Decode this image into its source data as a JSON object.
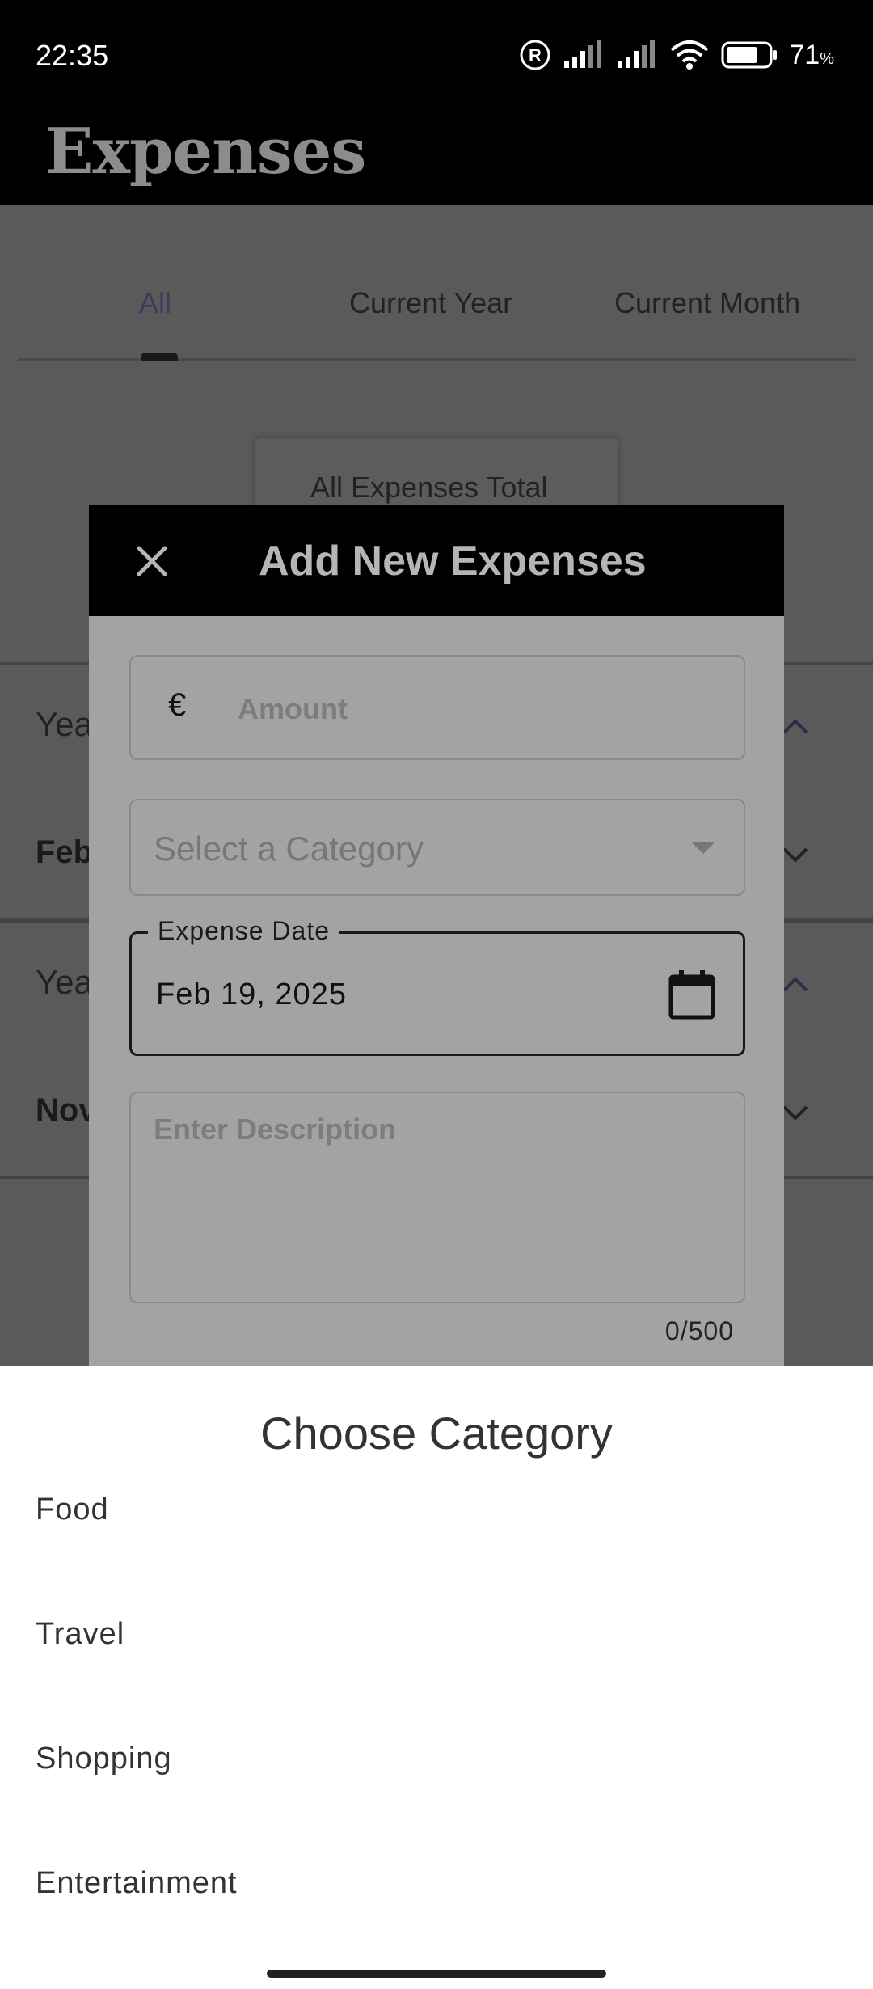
{
  "status": {
    "time": "22:35",
    "battery": "71",
    "battery_unit": "%"
  },
  "app": {
    "title": "Expenses"
  },
  "tabs": [
    {
      "label": "All",
      "active": true
    },
    {
      "label": "Current Year",
      "active": false
    },
    {
      "label": "Current Month",
      "active": false
    }
  ],
  "total_card": {
    "label": "All Expenses Total"
  },
  "groups": [
    {
      "year_label": "Yea",
      "month_label": "Feb"
    },
    {
      "year_label": "Yea",
      "month_label": "Nov"
    }
  ],
  "dialog": {
    "title": "Add New Expenses",
    "amount": {
      "symbol": "€",
      "placeholder": "Amount"
    },
    "category": {
      "placeholder": "Select a Category"
    },
    "date": {
      "label": "Expense Date",
      "value": "Feb 19, 2025"
    },
    "description": {
      "placeholder": "Enter Description",
      "counter": "0/500"
    }
  },
  "sheet": {
    "title": "Choose Category",
    "options": [
      "Food",
      "Travel",
      "Shopping",
      "Entertainment"
    ]
  },
  "colors": {
    "background_dim": "#555555",
    "dialog_bg": "#a3a3a3",
    "header_bg": "#000000",
    "active_tab": "#3e3a5c"
  }
}
